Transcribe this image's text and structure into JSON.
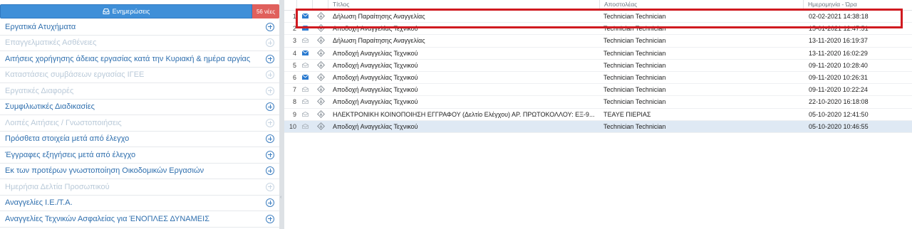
{
  "sidebar": {
    "updates_button": "Ενημερώσεις",
    "new_badge": "56 νέες",
    "items": [
      {
        "label": "Εργατικά Ατυχήματα",
        "enabled": true
      },
      {
        "label": "Επαγγελματικές Ασθένειες",
        "enabled": false
      },
      {
        "label": "Αιτήσεις χορήγησης άδειας εργασίας κατά την Κυριακή & ημέρα αργίας",
        "enabled": true
      },
      {
        "label": "Καταστάσεις συμβάσεων εργασίας ΙΓΕΕ",
        "enabled": false
      },
      {
        "label": "Εργατικές Διαφορές",
        "enabled": false
      },
      {
        "label": "Συμφιλιωτικές Διαδικασίες",
        "enabled": true
      },
      {
        "label": "Λοιπές Αιτήσεις / Γνωστοποιήσεις",
        "enabled": false
      },
      {
        "label": "Πρόσθετα στοιχεία μετά από έλεγχο",
        "enabled": true
      },
      {
        "label": "Έγγραφες εξηγήσεις μετά από έλεγχο",
        "enabled": true
      },
      {
        "label": "Εκ των προτέρων γνωστοποίηση Οικοδομικών Εργασιών",
        "enabled": true
      },
      {
        "label": "Ημερήσια Δελτία Προσωπικού",
        "enabled": false
      },
      {
        "label": "Αναγγελίες Ι.Ε./Τ.Α.",
        "enabled": true
      },
      {
        "label": "Αναγγελίες Τεχνικών Ασφαλείας για ΈΝΟΠΛΕΣ ΔΥΝΑΜΕΙΣ",
        "enabled": true
      }
    ]
  },
  "grid": {
    "columns": {
      "title": "Τίτλος",
      "sender": "Αποστολέας",
      "date": "Ημερομηνία - Ώρα"
    },
    "rows": [
      {
        "num": "1",
        "title": "Δήλωση Παραίτησης Αναγγελίας",
        "sender": "Technician Technician",
        "date": "02-02-2021 14:38:18",
        "unread": true
      },
      {
        "num": "2",
        "title": "Αποδοχή Αναγγελίας Τεχνικού",
        "sender": "Technician Technician",
        "date": "15-01-2021 12:47:51",
        "unread": true
      },
      {
        "num": "3",
        "title": "Δήλωση Παραίτησης Αναγγελίας",
        "sender": "Technician Technician",
        "date": "13-11-2020 16:19:37",
        "unread": false
      },
      {
        "num": "4",
        "title": "Αποδοχή Αναγγελίας Τεχνικού",
        "sender": "Technician Technician",
        "date": "13-11-2020 16:02:29",
        "unread": true
      },
      {
        "num": "5",
        "title": "Αποδοχή Αναγγελίας Τεχνικού",
        "sender": "Technician Technician",
        "date": "09-11-2020 10:28:40",
        "unread": false
      },
      {
        "num": "6",
        "title": "Αποδοχή Αναγγελίας Τεχνικού",
        "sender": "Technician Technician",
        "date": "09-11-2020 10:26:31",
        "unread": true
      },
      {
        "num": "7",
        "title": "Αποδοχή Αναγγελίας Τεχνικού",
        "sender": "Technician Technician",
        "date": "09-11-2020 10:22:24",
        "unread": false
      },
      {
        "num": "8",
        "title": "Αποδοχή Αναγγελίας Τεχνικού",
        "sender": "Technician Technician",
        "date": "22-10-2020 16:18:08",
        "unread": false
      },
      {
        "num": "9",
        "title": "ΗΛΕΚΤΡΟΝΙΚΗ ΚΟΙΝΟΠΟΙΗΣΗ ΕΓΓΡΑΦΟΥ (Δελτίο Ελέγχου) ΑΡ. ΠΡΩΤΟΚΟΛΛΟΥ: ΕΞ-9...",
        "sender": "ΤΕΑΥΕ ΠΙΕΡΙΑΣ",
        "date": "05-10-2020 12:41:50",
        "unread": false
      },
      {
        "num": "10",
        "title": "Αποδοχή Αναγγελίας Τεχνικού",
        "sender": "Technician Technician",
        "date": "05-10-2020 10:46:55",
        "unread": false,
        "selected": true
      }
    ]
  },
  "colors": {
    "accent": "#3f8fd8",
    "badge": "#e0605c",
    "highlight": "#d01a20",
    "unread_icon": "#2b7bd0"
  }
}
